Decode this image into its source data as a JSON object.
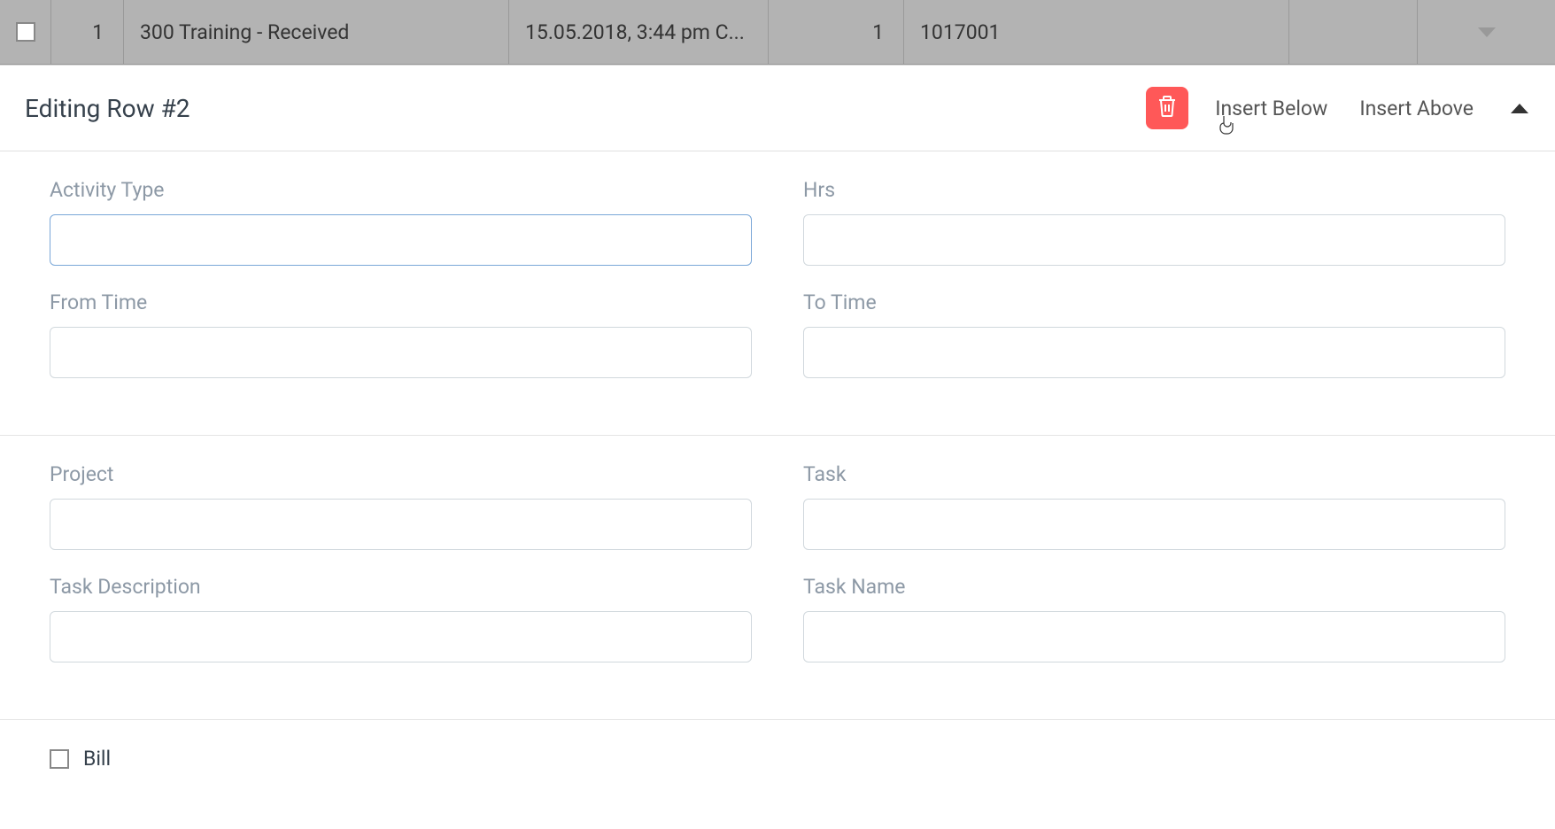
{
  "header_row": {
    "serial": "1",
    "activity": "300 Training - Received",
    "timestamp": "15.05.2018, 3:44 pm C...",
    "qty": "1",
    "code": "1017001"
  },
  "panel": {
    "title": "Editing Row #2",
    "delete_icon": "trash-icon",
    "insert_below": "Insert Below",
    "insert_above": "Insert Above"
  },
  "fields": {
    "activity_type": {
      "label": "Activity Type",
      "value": ""
    },
    "hrs": {
      "label": "Hrs",
      "value": ""
    },
    "from_time": {
      "label": "From Time",
      "value": ""
    },
    "to_time": {
      "label": "To Time",
      "value": ""
    },
    "project": {
      "label": "Project",
      "value": ""
    },
    "task": {
      "label": "Task",
      "value": ""
    },
    "task_description": {
      "label": "Task Description",
      "value": ""
    },
    "task_name": {
      "label": "Task Name",
      "value": ""
    },
    "bill": {
      "label": "Bill",
      "checked": false
    }
  }
}
